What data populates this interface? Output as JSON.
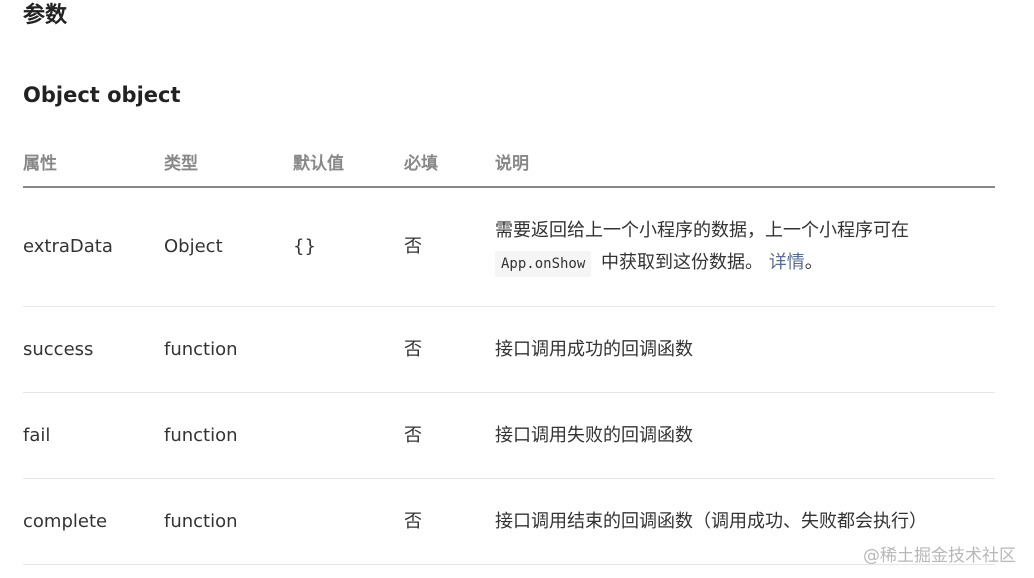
{
  "section_title": "参数",
  "sub_title": "Object object",
  "table": {
    "headers": [
      "属性",
      "类型",
      "默认值",
      "必填",
      "说明"
    ],
    "rows": [
      {
        "name": "extraData",
        "type": "Object",
        "default": "{}",
        "required": "否",
        "desc_pre": "需要返回给上一个小程序的数据，上一个小程序可在",
        "desc_code": "App.onShow",
        "desc_mid": " 中获取到这份数据。",
        "desc_link": "详情",
        "desc_post": "。"
      },
      {
        "name": "success",
        "type": "function",
        "default": "",
        "required": "否",
        "desc": "接口调用成功的回调函数"
      },
      {
        "name": "fail",
        "type": "function",
        "default": "",
        "required": "否",
        "desc": "接口调用失败的回调函数"
      },
      {
        "name": "complete",
        "type": "function",
        "default": "",
        "required": "否",
        "desc": "接口调用结束的回调函数（调用成功、失败都会执行）"
      }
    ]
  },
  "watermark": "@稀土掘金技术社区"
}
